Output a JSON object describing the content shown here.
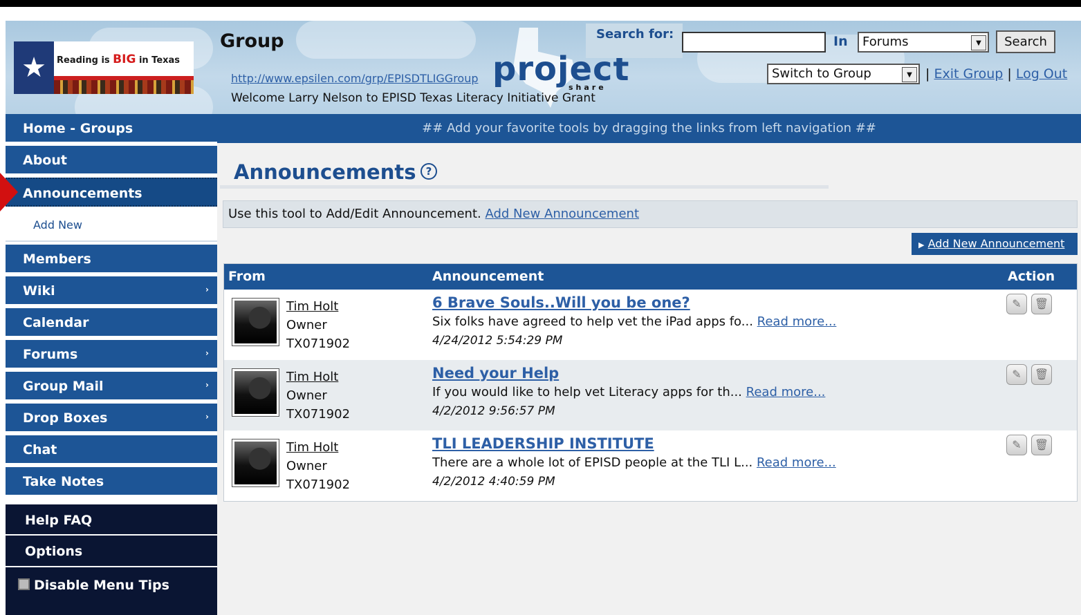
{
  "header": {
    "logo_text_pre": "Reading is ",
    "logo_text_big": "BIG",
    "logo_text_post": " in Texas",
    "group_title": "Group",
    "group_url": "http://www.epsilen.com/grp/EPISDTLIGGroup",
    "welcome": "Welcome Larry Nelson to EPISD Texas Literacy Initiative Grant",
    "brand_word": "project",
    "brand_sub": "share",
    "search_label": "Search for:",
    "search_value": "",
    "in_label": "In",
    "scope_selected": "Forums",
    "search_button": "Search",
    "switch_selected": "Switch to Group",
    "sep": "|",
    "exit_group": "Exit Group",
    "log_out": "Log Out"
  },
  "sidebar": {
    "items": [
      {
        "label": "Home - Groups"
      },
      {
        "label": "About"
      },
      {
        "label": "Announcements"
      },
      {
        "label": "Add New"
      },
      {
        "label": "Members"
      },
      {
        "label": "Wiki"
      },
      {
        "label": "Calendar"
      },
      {
        "label": "Forums"
      },
      {
        "label": "Group Mail"
      },
      {
        "label": "Drop Boxes"
      },
      {
        "label": "Chat"
      },
      {
        "label": "Take Notes"
      }
    ],
    "help": "Help FAQ",
    "options": "Options",
    "disable_tips": "Disable Menu Tips",
    "chevron": "›"
  },
  "banner": "## Add your favorite tools by dragging the links from left navigation ##",
  "main": {
    "title": "Announcements",
    "help_glyph": "?",
    "info_text": "Use this tool to Add/Edit Announcement. ",
    "info_link": "Add New Announcement",
    "add_button_arrow": "▶",
    "add_button": "Add New Announcement",
    "columns": {
      "from": "From",
      "announcement": "Announcement",
      "action": "Action"
    },
    "rows": [
      {
        "author": "Tim Holt",
        "role": "Owner",
        "code": "TX071902",
        "title": "6 Brave Souls..Will you be one?",
        "excerpt": "Six folks have agreed to help vet the iPad apps fo... ",
        "read_more": "Read more...",
        "date": "4/24/2012 5:54:29 PM"
      },
      {
        "author": "Tim Holt",
        "role": "Owner",
        "code": "TX071902",
        "title": "Need your Help",
        "excerpt": "If you would like to help vet Literacy apps for th... ",
        "read_more": "Read more...",
        "date": "4/2/2012 9:56:57 PM"
      },
      {
        "author": "Tim Holt",
        "role": "Owner",
        "code": "TX071902",
        "title": "TLI LEADERSHIP INSTITUTE",
        "excerpt": "There are a whole lot of EPISD people at the TLI L... ",
        "read_more": "Read more...",
        "date": "4/2/2012 4:40:59 PM"
      }
    ],
    "icons": {
      "edit": "pencil-icon",
      "delete": "trash-icon"
    }
  }
}
